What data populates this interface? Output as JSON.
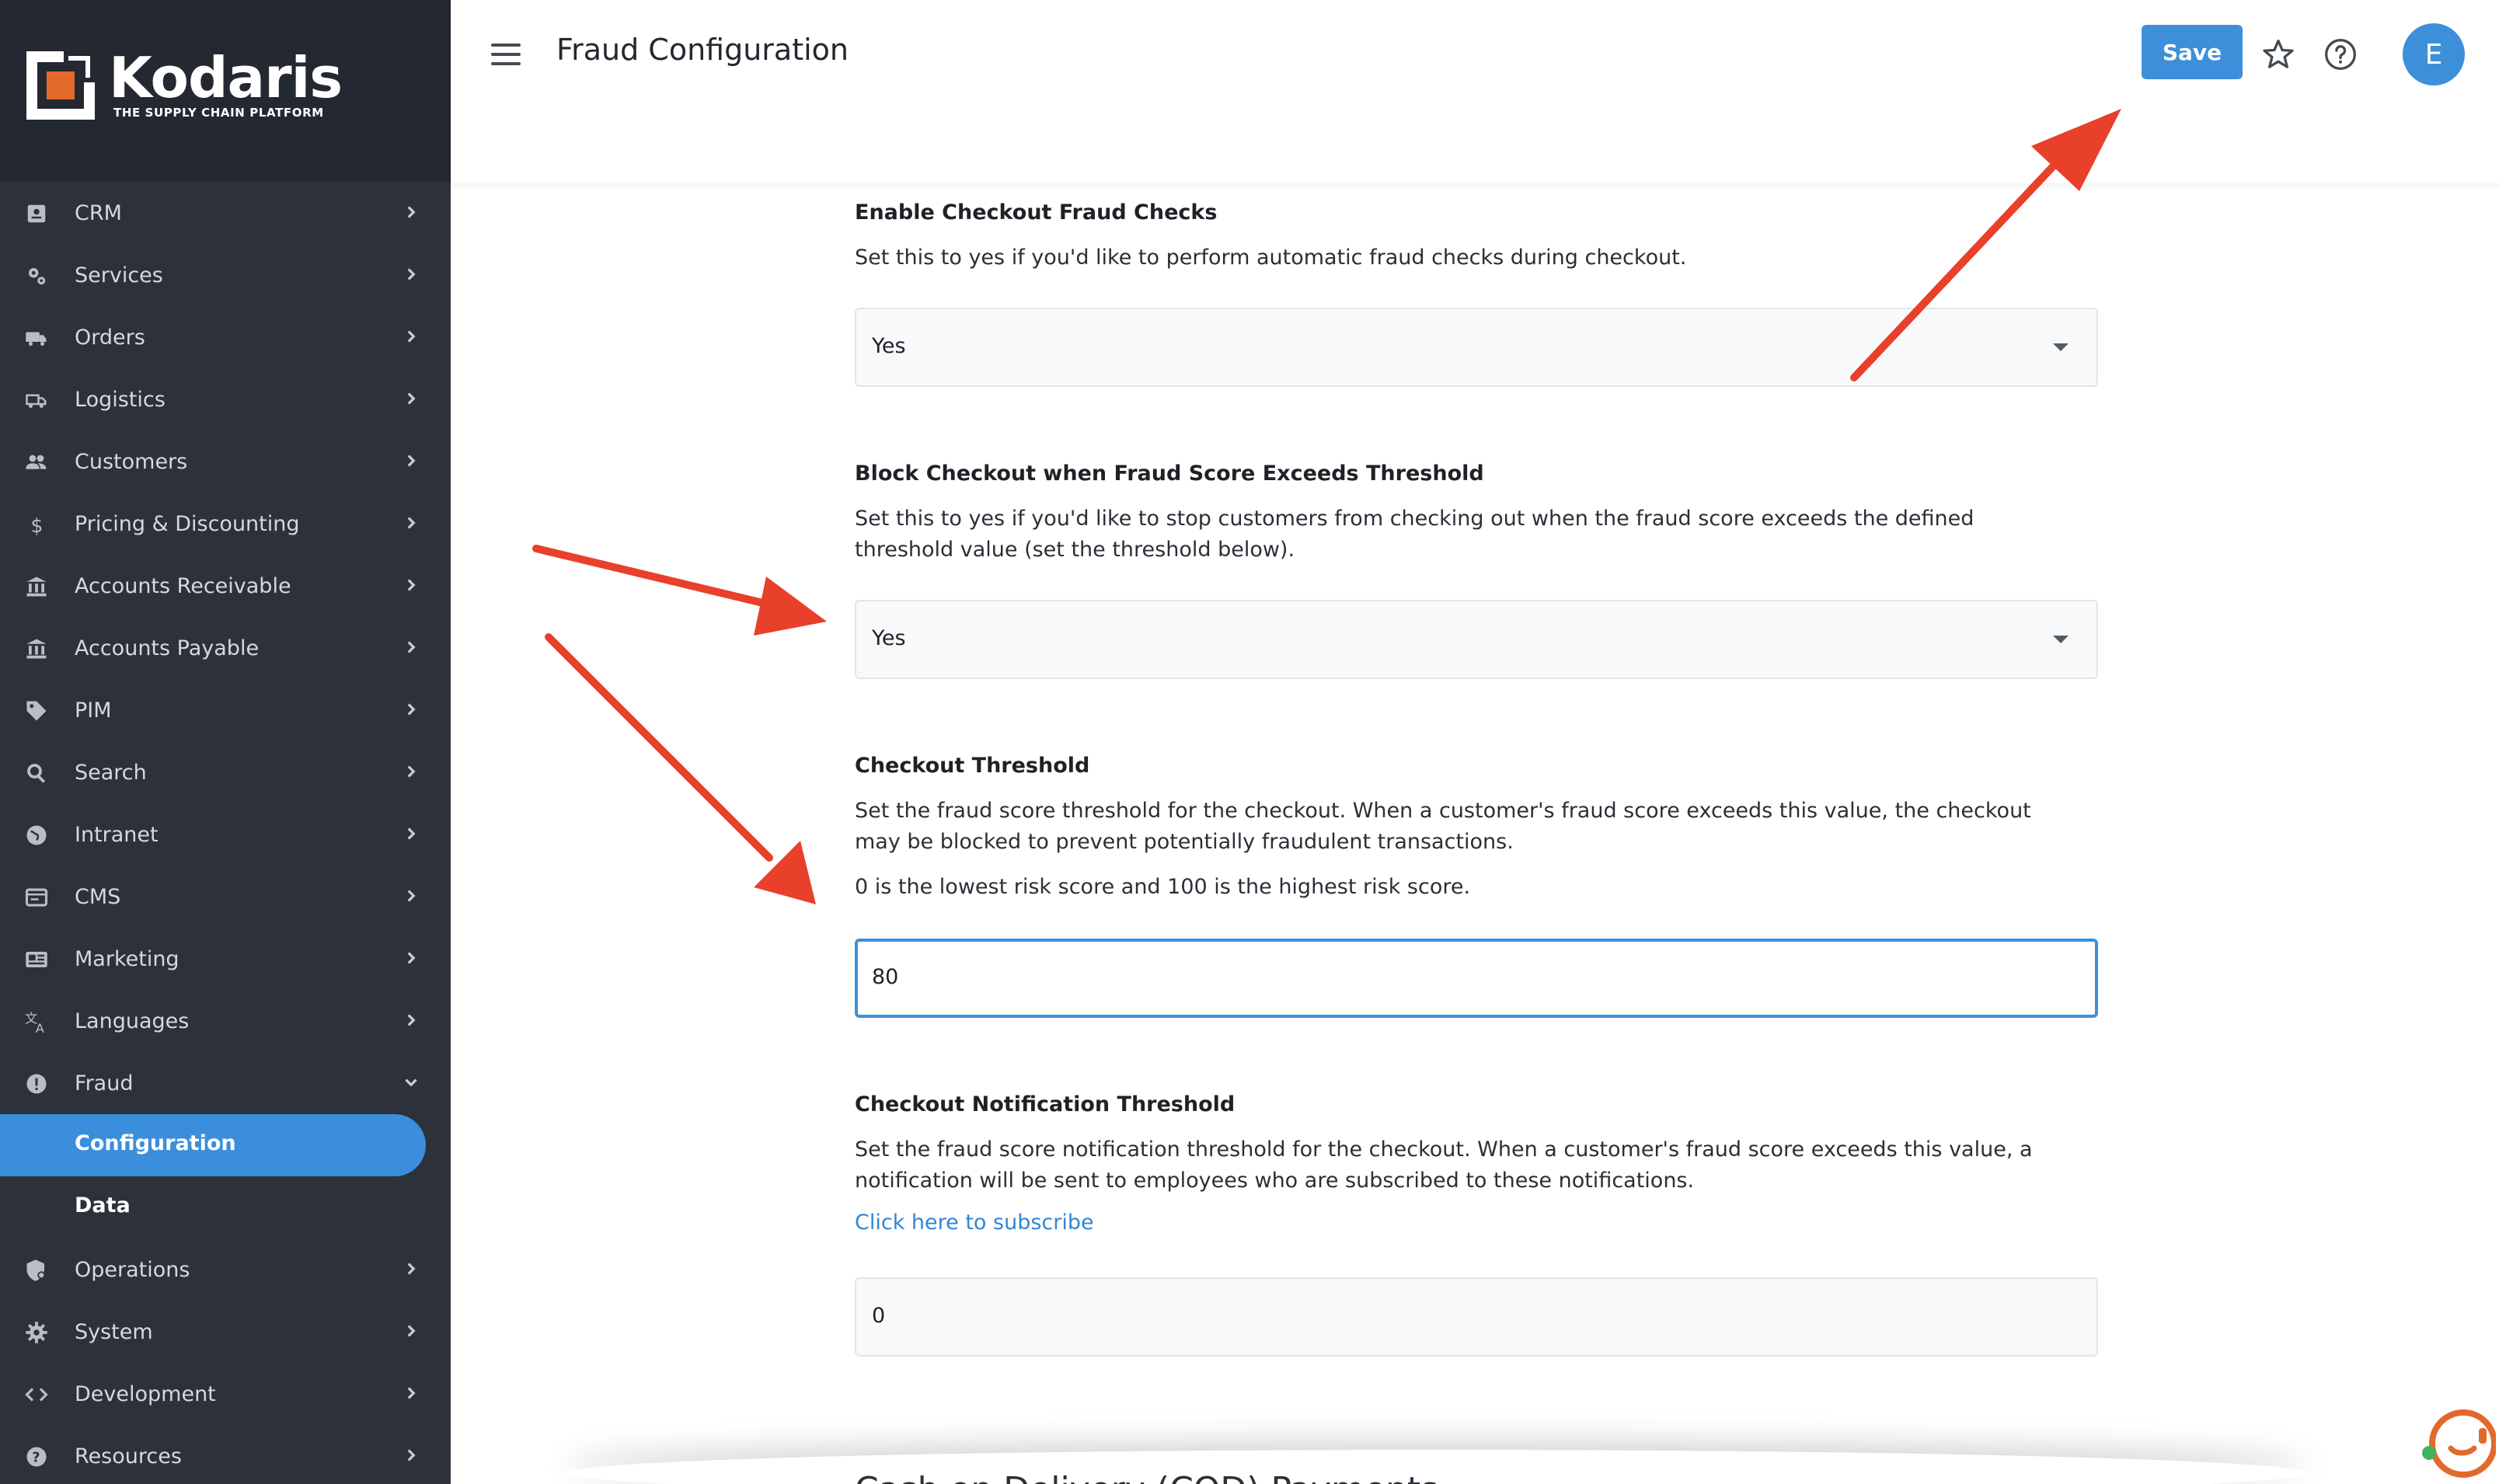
{
  "brand": {
    "name": "Kodaris",
    "tagline": "THE SUPPLY CHAIN PLATFORM"
  },
  "sidebar": {
    "items": [
      {
        "label": "CRM",
        "icon": "contact-card-icon",
        "chevron": "right"
      },
      {
        "label": "Services",
        "icon": "gears-icon",
        "chevron": "right"
      },
      {
        "label": "Orders",
        "icon": "truck-icon",
        "chevron": "right"
      },
      {
        "label": "Logistics",
        "icon": "shipping-truck-icon",
        "chevron": "right"
      },
      {
        "label": "Customers",
        "icon": "people-icon",
        "chevron": "right"
      },
      {
        "label": "Pricing & Discounting",
        "icon": "dollar-icon",
        "chevron": "right"
      },
      {
        "label": "Accounts Receivable",
        "icon": "bank-icon",
        "chevron": "right"
      },
      {
        "label": "Accounts Payable",
        "icon": "bank-icon",
        "chevron": "right"
      },
      {
        "label": "PIM",
        "icon": "tag-icon",
        "chevron": "right"
      },
      {
        "label": "Search",
        "icon": "search-icon",
        "chevron": "right"
      },
      {
        "label": "Intranet",
        "icon": "globe-icon",
        "chevron": "right"
      },
      {
        "label": "CMS",
        "icon": "window-icon",
        "chevron": "right"
      },
      {
        "label": "Marketing",
        "icon": "newspaper-icon",
        "chevron": "right"
      },
      {
        "label": "Languages",
        "icon": "translate-icon",
        "chevron": "right"
      },
      {
        "label": "Fraud",
        "icon": "alert-icon",
        "chevron": "down"
      }
    ],
    "fraud_sub": [
      {
        "label": "Configuration",
        "active": true
      },
      {
        "label": "Data",
        "active": false
      }
    ],
    "items_after": [
      {
        "label": "Operations",
        "icon": "shield-gear-icon",
        "chevron": "right"
      },
      {
        "label": "System",
        "icon": "gear-icon",
        "chevron": "right"
      },
      {
        "label": "Development",
        "icon": "code-icon",
        "chevron": "right"
      },
      {
        "label": "Resources",
        "icon": "help-icon",
        "chevron": "right"
      }
    ]
  },
  "header": {
    "title": "Fraud Configuration",
    "save_label": "Save",
    "avatar_initial": "E",
    "icons": [
      "menu-icon",
      "star-icon",
      "help-circle-icon"
    ]
  },
  "form": {
    "fraud_checks": {
      "title": "Enable Checkout Fraud Checks",
      "description": "Set this to yes if you'd like to perform automatic fraud checks during checkout.",
      "value": "Yes"
    },
    "block_checkout": {
      "title": "Block Checkout when Fraud Score Exceeds Threshold",
      "description": "Set this to yes if you'd like to stop customers from checking out when the fraud score exceeds the defined threshold value (set the threshold below).",
      "value": "Yes"
    },
    "checkout_threshold": {
      "title": "Checkout Threshold",
      "description": "Set the fraud score threshold for the checkout. When a customer's fraud score exceeds this value, the checkout may be blocked to prevent potentially fraudulent transactions.",
      "note": "0 is the lowest risk score and 100 is the highest risk score.",
      "value": "80"
    },
    "notification_threshold": {
      "title": "Checkout Notification Threshold",
      "description": "Set the fraud score notification threshold for the checkout. When a customer's fraud score exceeds this value, a notification will be sent to employees who are subscribed to these notifications.",
      "link": "Click here to subscribe",
      "value": "0"
    },
    "next_section": "Cash on Delivery (COD) Payments"
  },
  "colors": {
    "sidebar_bg": "#2c313a",
    "brand_bg": "#242830",
    "accent": "#3d8fd9",
    "brand_orange": "#e3692b",
    "annotation_arrow": "#e8402a",
    "link": "#2f86d8"
  }
}
